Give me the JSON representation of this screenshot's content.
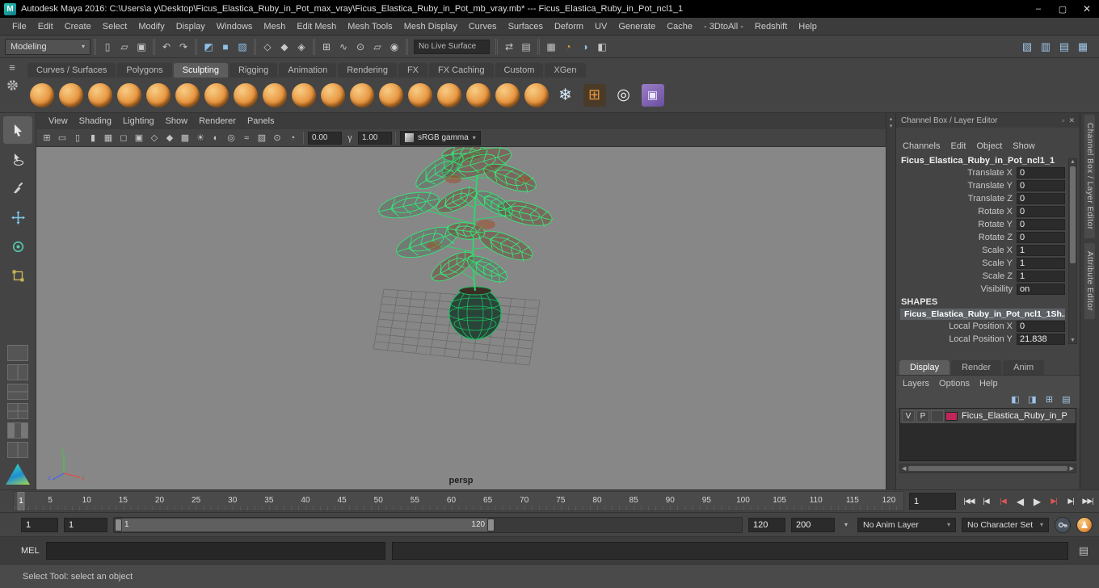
{
  "titlebar": {
    "title": "Autodesk Maya 2016: C:\\Users\\a y\\Desktop\\Ficus_Elastica_Ruby_in_Pot_max_vray\\Ficus_Elastica_Ruby_in_Pot_mb_vray.mb*  ---  Ficus_Elastica_Ruby_in_Pot_ncl1_1",
    "logo_glyph": "M",
    "minimize_glyph": "–",
    "maximize_glyph": "▢",
    "close_glyph": "✕"
  },
  "menubar": {
    "items": [
      "File",
      "Edit",
      "Create",
      "Select",
      "Modify",
      "Display",
      "Windows",
      "Mesh",
      "Edit Mesh",
      "Mesh Tools",
      "Mesh Display",
      "Curves",
      "Surfaces",
      "Deform",
      "UV",
      "Generate",
      "Cache",
      "- 3DtoAll -",
      "Redshift",
      "Help"
    ]
  },
  "statusline": {
    "mode_selector": "Modeling",
    "caret_glyph": "▾",
    "groups": [
      {
        "id": "scene",
        "icons": [
          {
            "name": "new-scene-icon",
            "glyph": "▯"
          },
          {
            "name": "open-scene-icon",
            "glyph": "▱"
          },
          {
            "name": "save-scene-icon",
            "glyph": "▣"
          }
        ]
      },
      {
        "id": "history",
        "icons": [
          {
            "name": "undo-icon",
            "glyph": "↶"
          },
          {
            "name": "redo-icon",
            "glyph": "↷"
          }
        ]
      },
      {
        "id": "selection-mode",
        "icons": [
          {
            "name": "select-hierarchy-icon",
            "glyph": "◩",
            "tint": "blue"
          },
          {
            "name": "select-object-icon",
            "glyph": "■",
            "tint": "blue"
          },
          {
            "name": "select-component-icon",
            "glyph": "▨",
            "tint": "blue"
          }
        ]
      },
      {
        "id": "selection-masks",
        "icons": [
          {
            "name": "select-all-mask-icon",
            "glyph": "◇"
          },
          {
            "name": "select-handles-mask-icon",
            "glyph": "◆"
          },
          {
            "name": "select-joints-mask-icon",
            "glyph": "◈"
          }
        ]
      },
      {
        "id": "snapping",
        "icons": [
          {
            "name": "snap-to-grid-icon",
            "glyph": "⊞"
          },
          {
            "name": "snap-to-curve-icon",
            "glyph": "∿"
          },
          {
            "name": "snap-to-point-icon",
            "glyph": "⊙"
          },
          {
            "name": "snap-to-plane-icon",
            "glyph": "▱"
          },
          {
            "name": "make-live-icon",
            "glyph": "◉"
          }
        ]
      },
      {
        "id": "live-surface",
        "field": {
          "name": "live-surface-field",
          "label": "No Live Surface"
        }
      },
      {
        "id": "construction",
        "icons": [
          {
            "name": "construction-history-icon",
            "glyph": "⇄"
          },
          {
            "name": "open-editor-icon",
            "glyph": "▤"
          }
        ]
      },
      {
        "id": "rendering",
        "icons": [
          {
            "name": "render-view-icon",
            "glyph": "▦"
          },
          {
            "name": "render-current-frame-icon",
            "glyph": "◔",
            "tint": "orange"
          },
          {
            "name": "ipr-render-icon",
            "glyph": "◑",
            "tint": "blue"
          },
          {
            "name": "render-settings-icon",
            "glyph": "◧"
          }
        ]
      }
    ],
    "right_icons": [
      {
        "name": "modeling-toolkit-toggle-icon",
        "glyph": "▧"
      },
      {
        "name": "channel-box-toggle-icon",
        "glyph": "▥"
      },
      {
        "name": "layer-editor-toggle-icon",
        "glyph": "▤"
      },
      {
        "name": "attribute-editor-toggle-icon",
        "glyph": "▦"
      }
    ]
  },
  "shelf": {
    "tabs": [
      "Curves / Surfaces",
      "Polygons",
      "Sculpting",
      "Rigging",
      "Animation",
      "Rendering",
      "FX",
      "FX Caching",
      "Custom",
      "XGen"
    ],
    "active_tab": "Sculpting",
    "menu_glyph": "≡",
    "tools": [
      {
        "name": "sculpt-tool",
        "kind": "orange"
      },
      {
        "name": "smooth-tool",
        "kind": "orange"
      },
      {
        "name": "relax-tool",
        "kind": "orange"
      },
      {
        "name": "grab-tool",
        "kind": "orange"
      },
      {
        "name": "pinch-tool",
        "kind": "orange"
      },
      {
        "name": "flatten-tool",
        "kind": "orange"
      },
      {
        "name": "foamy-tool",
        "kind": "orange"
      },
      {
        "name": "spray-tool",
        "kind": "orange"
      },
      {
        "name": "repeat-tool",
        "kind": "orange"
      },
      {
        "name": "imprint-tool",
        "kind": "orange"
      },
      {
        "name": "wax-tool",
        "kind": "orange"
      },
      {
        "name": "scrape-tool",
        "kind": "orange"
      },
      {
        "name": "fill-tool",
        "kind": "orange"
      },
      {
        "name": "knife-tool",
        "kind": "orange"
      },
      {
        "name": "smear-tool",
        "kind": "orange"
      },
      {
        "name": "bulge-tool",
        "kind": "orange"
      },
      {
        "name": "amplify-tool",
        "kind": "orange"
      },
      {
        "name": "freeze-mask-tool",
        "kind": "orange"
      },
      {
        "name": "freeze-tool",
        "kind": "snow",
        "glyph": "❄"
      },
      {
        "name": "convert-to-frozen-tool",
        "kind": "gridspecial",
        "glyph": "⊞"
      },
      {
        "name": "sculpt-falloff-tool",
        "kind": "circles",
        "glyph": "◎"
      },
      {
        "name": "sculpt-objects-tool",
        "kind": "purple",
        "glyph": "▣"
      }
    ]
  },
  "toolbox": {
    "tools": [
      {
        "name": "select-tool",
        "active": true
      },
      {
        "name": "lasso-tool"
      },
      {
        "name": "paint-selection-tool"
      },
      {
        "name": "move-tool"
      },
      {
        "name": "rotate-tool"
      },
      {
        "name": "scale-tool"
      }
    ]
  },
  "viewport": {
    "menus": [
      "View",
      "Shading",
      "Lighting",
      "Show",
      "Renderer",
      "Panels"
    ],
    "toolbar_icons": [
      {
        "name": "grid-toggle-icon",
        "glyph": "⊞"
      },
      {
        "name": "film-gate-icon",
        "glyph": "▭"
      },
      {
        "name": "resolution-gate-icon",
        "glyph": "▯"
      },
      {
        "name": "gate-mask-icon",
        "glyph": "▮"
      },
      {
        "name": "field-chart-icon",
        "glyph": "▦"
      },
      {
        "name": "safe-action-icon",
        "glyph": "◻"
      },
      {
        "name": "safe-title-icon",
        "glyph": "▣"
      },
      {
        "name": "wireframe-mode-icon",
        "glyph": "◇"
      },
      {
        "name": "shaded-mode-icon",
        "glyph": "◆"
      },
      {
        "name": "textured-mode-icon",
        "glyph": "▩"
      },
      {
        "name": "use-all-lights-icon",
        "glyph": "☀"
      },
      {
        "name": "shadows-icon",
        "glyph": "◐"
      },
      {
        "name": "occlusion-icon",
        "glyph": "◎"
      },
      {
        "name": "motion-blur-icon",
        "glyph": "≈"
      },
      {
        "name": "xray-icon",
        "glyph": "▨"
      },
      {
        "name": "isolate-select-icon",
        "glyph": "⊙"
      },
      {
        "name": "exposure-icon",
        "glyph": "◔"
      }
    ],
    "exposure": "0.00",
    "gamma_icon_glyph": "γ",
    "gamma": "1.00",
    "color_transform": "sRGB gamma",
    "camera": "persp",
    "strip_up_glyph": "▴",
    "strip_down_glyph": "▾"
  },
  "channel_box": {
    "title": "Channel Box / Layer Editor",
    "header_icons": [
      {
        "name": "dock-icon",
        "glyph": "▫"
      },
      {
        "name": "close-icon",
        "glyph": "✕"
      }
    ],
    "menus": [
      "Channels",
      "Edit",
      "Object",
      "Show"
    ],
    "object_name": "Ficus_Elastica_Ruby_in_Pot_ncl1_1",
    "attributes": [
      {
        "label": "Translate X",
        "value": "0"
      },
      {
        "label": "Translate Y",
        "value": "0"
      },
      {
        "label": "Translate Z",
        "value": "0"
      },
      {
        "label": "Rotate X",
        "value": "0"
      },
      {
        "label": "Rotate Y",
        "value": "0"
      },
      {
        "label": "Rotate Z",
        "value": "0"
      },
      {
        "label": "Scale X",
        "value": "1"
      },
      {
        "label": "Scale Y",
        "value": "1"
      },
      {
        "label": "Scale Z",
        "value": "1"
      },
      {
        "label": "Visibility",
        "value": "on"
      }
    ],
    "shapes_label": "SHAPES",
    "shape_name": "Ficus_Elastica_Ruby_in_Pot_ncl1_1Sh...",
    "shape_attributes": [
      {
        "label": "Local Position X",
        "value": "0"
      },
      {
        "label": "Local Position Y",
        "value": "21.838"
      }
    ],
    "scroll_up_glyph": "▲",
    "scroll_down_glyph": "▼"
  },
  "layer_editor": {
    "tabs": [
      "Display",
      "Render",
      "Anim"
    ],
    "active_tab": "Display",
    "menus": [
      "Layers",
      "Options",
      "Help"
    ],
    "toolbar_icons": [
      {
        "name": "move-layer-up-icon",
        "glyph": "◧"
      },
      {
        "name": "move-layer-down-icon",
        "glyph": "◨"
      },
      {
        "name": "new-empty-layer-icon",
        "glyph": "⊞"
      },
      {
        "name": "new-layer-from-selected-icon",
        "glyph": "▤"
      }
    ],
    "layers": [
      {
        "visible": "V",
        "playback": "P",
        "reference": "",
        "color": "#c0265a",
        "name": "Ficus_Elastica_Ruby_in_P"
      }
    ],
    "hscroll_left_glyph": "◀",
    "hscroll_right_glyph": "▶"
  },
  "right_dock_tabs": [
    "Channel Box / Layer Editor",
    "Attribute Editor"
  ],
  "time_slider": {
    "current_frame": "1",
    "ticks": [
      5,
      10,
      15,
      20,
      25,
      30,
      35,
      40,
      45,
      50,
      55,
      60,
      65,
      70,
      75,
      80,
      85,
      90,
      95,
      100,
      105,
      110,
      115,
      120
    ],
    "frame_field": "1",
    "playback": [
      {
        "name": "go-to-start-button",
        "glyph": "|◀◀"
      },
      {
        "name": "step-back-frame-button",
        "glyph": "|◀"
      },
      {
        "name": "step-back-key-button",
        "glyph": "|◀",
        "accent": true
      },
      {
        "name": "play-backwards-button",
        "glyph": "◀",
        "big": true
      },
      {
        "name": "play-forwards-button",
        "glyph": "▶",
        "big": true
      },
      {
        "name": "step-forward-key-button",
        "glyph": "▶|",
        "accent": true
      },
      {
        "name": "step-forward-frame-button",
        "glyph": "▶|"
      },
      {
        "name": "go-to-end-button",
        "glyph": "▶▶|"
      }
    ]
  },
  "range_slider": {
    "anim_start": "1",
    "playback_start": "1",
    "range_label_start": "1",
    "range_label_end": "120",
    "playback_end": "120",
    "anim_end": "200",
    "caret_glyph": "▾",
    "anim_layer": "No Anim Layer",
    "character_set": "No Character Set",
    "character_glyph": "♟"
  },
  "command_line": {
    "label": "MEL",
    "expand_glyph": "▤"
  },
  "help_line": {
    "text": "Select Tool: select an object"
  },
  "colors": {
    "wireframe_green": "#35e878",
    "shelf_orange": "#e8953f",
    "layer_swatch": "#c0265a",
    "viewport_bg": "#878787"
  }
}
